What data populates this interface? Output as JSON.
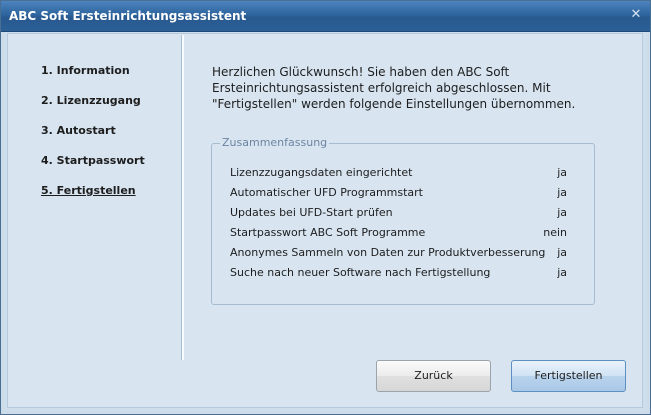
{
  "window": {
    "title": "ABC Soft Ersteinrichtungsassistent",
    "close_icon": "close-icon"
  },
  "steps": [
    {
      "label": "1. Information",
      "active": false
    },
    {
      "label": "2. Lizenzzugang",
      "active": false
    },
    {
      "label": "3. Autostart",
      "active": false
    },
    {
      "label": "4. Startpasswort",
      "active": false
    },
    {
      "label": "5. Fertigstellen",
      "active": true
    }
  ],
  "intro": {
    "text": "Herzlichen Glückwunsch! Sie haben den ABC Soft\nErsteinrichtungsassistent erfolgreich abgeschlossen. Mit\n\"Fertigstellen\" werden folgende Einstellungen übernommen."
  },
  "summary": {
    "legend": "Zusammenfassung",
    "rows": [
      {
        "label": "Lizenzzugangsdaten eingerichtet",
        "value": "ja"
      },
      {
        "label": "Automatischer UFD Programmstart",
        "value": "ja"
      },
      {
        "label": "Updates bei UFD-Start prüfen",
        "value": "ja"
      },
      {
        "label": "Startpasswort ABC Soft Programme",
        "value": "nein"
      },
      {
        "label": "Anonymes Sammeln von Daten zur Produktverbesserung",
        "value": "ja"
      },
      {
        "label": "Suche nach neuer Software nach Fertigstellung",
        "value": "ja"
      }
    ]
  },
  "buttons": {
    "back": "Zurück",
    "finish": "Fertigstellen"
  },
  "colors": {
    "titlebar": "#2e659f",
    "background": "#d8e5f1",
    "accent_button": "#b9d3ec"
  }
}
